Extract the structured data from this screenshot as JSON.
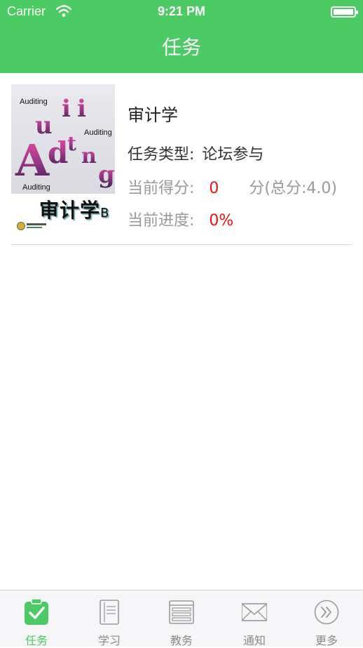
{
  "status_bar": {
    "carrier": "Carrier",
    "time": "9:21 PM"
  },
  "header": {
    "title": "任务"
  },
  "task": {
    "cover": {
      "art_words": [
        "Auditing",
        "Auditing",
        "Auditing"
      ],
      "title": "审计学",
      "title_suffix": "B"
    },
    "name": "审计学",
    "type_label": "任务类型:",
    "type_value": "论坛参与",
    "score_label": "当前得分:",
    "score_value": "0",
    "score_total": "分(总分:4.0)",
    "progress_label": "当前进度:",
    "progress_value": "0%"
  },
  "tabbar": {
    "items": [
      {
        "label": "任务",
        "icon": "clipboard-check-icon",
        "active": true
      },
      {
        "label": "学习",
        "icon": "document-icon"
      },
      {
        "label": "教务",
        "icon": "browser-window-icon"
      },
      {
        "label": "通知",
        "icon": "envelope-icon"
      },
      {
        "label": "更多",
        "icon": "double-chevron-circle-icon"
      }
    ]
  },
  "colors": {
    "accent": "#4cca63",
    "highlight": "#f01010"
  }
}
